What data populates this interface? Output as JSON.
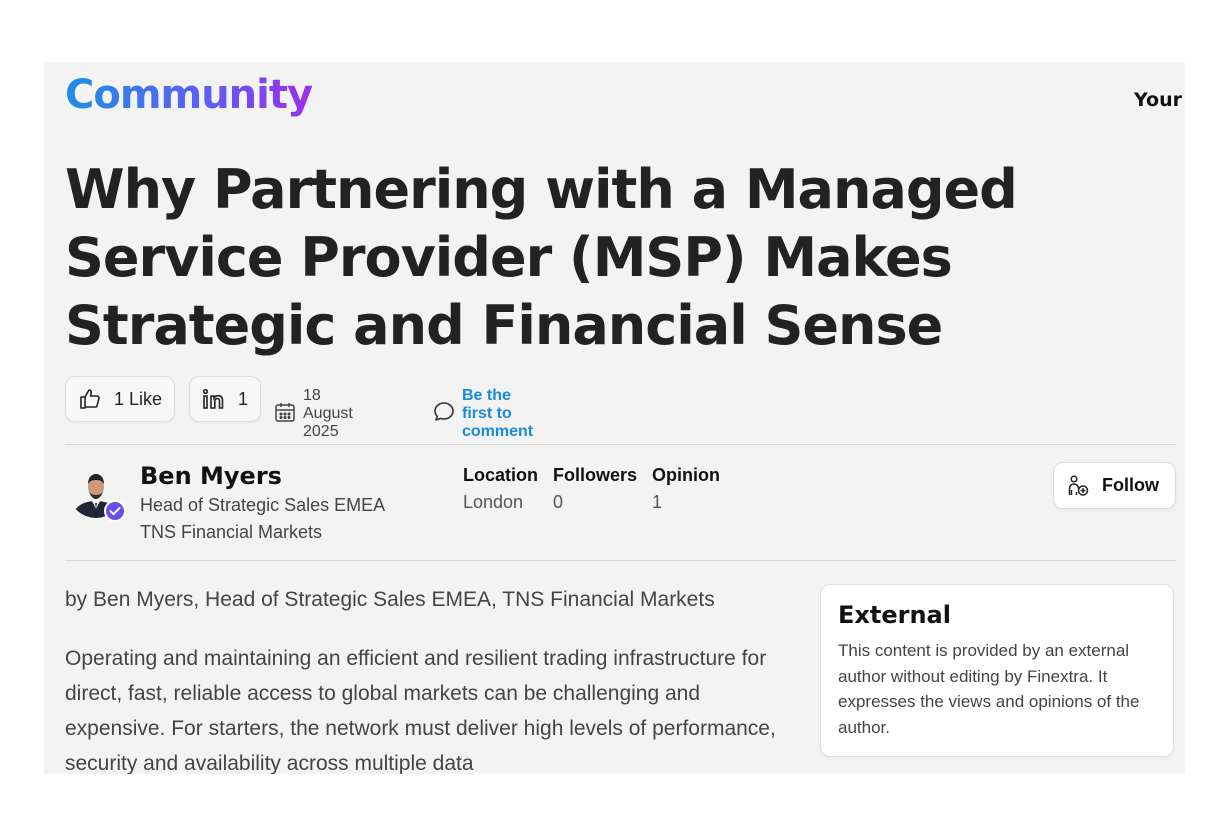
{
  "header": {
    "brand": "Community",
    "right_nav_text": "Your"
  },
  "article": {
    "title": "Why Partnering with a Managed Service Provider (MSP) Makes Strategic and Financial Sense",
    "likes_label": "1 Like",
    "linkedin_count": "1",
    "date": "18 August 2025",
    "comment_cta": "Be the first to comment",
    "byline": "by Ben Myers, Head of Strategic Sales EMEA, TNS Financial Markets",
    "body_excerpt": "Operating and maintaining an efficient and resilient trading infrastructure for direct, fast, reliable access to global markets can be challenging and expensive. For starters, the network must deliver high levels of performance, security and availability across multiple data"
  },
  "author": {
    "name": "Ben Myers",
    "role": "Head of Strategic Sales EMEA",
    "organization": "TNS Financial Markets",
    "stats": [
      {
        "label": "Location",
        "value": "London"
      },
      {
        "label": "Followers",
        "value": "0"
      },
      {
        "label": "Opinion",
        "value": "1"
      }
    ],
    "follow_label": "Follow"
  },
  "external_card": {
    "title": "External",
    "text": "This content is provided by an external author without editing by Finextra. It expresses the views and opinions of the author."
  },
  "icons": {
    "like": "thumbs-up-icon",
    "linkedin": "linkedin-icon",
    "date": "calendar-icon",
    "comment": "comment-bubble-icon",
    "follow": "follow-person-icon",
    "verified": "verified-badge-icon"
  },
  "colors": {
    "brand_gradient_start": "#1e8fe6",
    "brand_gradient_end": "#9b2ef0",
    "link_blue": "#1a8bd8",
    "verified_purple": "#6a4df0"
  }
}
